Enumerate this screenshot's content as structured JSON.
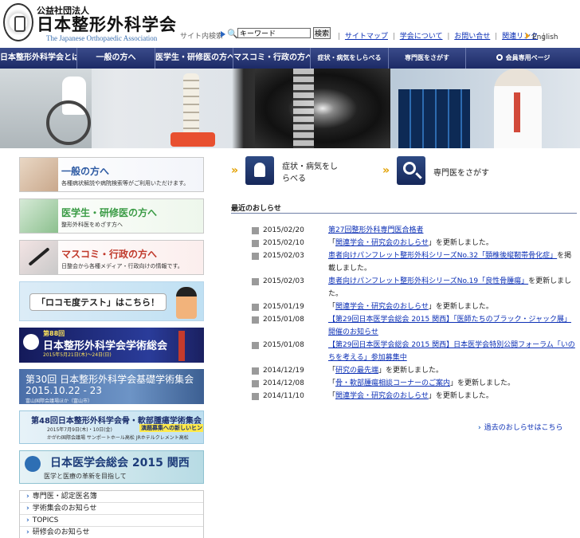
{
  "header": {
    "org_type": "公益社団法人",
    "org_name": "日本整形外科学会",
    "org_name_en": "The Japanese Orthopaedic Association",
    "search": {
      "label": "サイト内検索",
      "placeholder": "キーワード",
      "button": "検索"
    },
    "links": [
      {
        "label": "サイトマップ"
      },
      {
        "label": "学会について"
      },
      {
        "label": "お問い合せ"
      },
      {
        "label": "関連リンク"
      }
    ],
    "english_label": "English"
  },
  "nav": {
    "items": [
      {
        "label": "日本整形外科学会とは"
      },
      {
        "label": "一般の方へ"
      },
      {
        "label": "医学生・研修医の方へ"
      },
      {
        "label": "マスコミ・行政の方へ"
      },
      {
        "label": "症状・病気をしらべる"
      },
      {
        "label": "専門医をさがす"
      },
      {
        "label": "会員専用ページ"
      }
    ]
  },
  "sidebar": {
    "cards": [
      {
        "title": "一般の方へ",
        "desc": "各種病状解説や病院検索等がご利用いただけます。"
      },
      {
        "title": "医学生・研修医の方へ",
        "desc": "整形外科医をめざす方へ"
      },
      {
        "title": "マスコミ・行政の方へ",
        "desc": "日整会から各種メディア・行政向けの情報です。"
      }
    ],
    "locomo": {
      "label": "「ロコモ度テスト」はこちら！"
    },
    "events": {
      "e88": {
        "title": "第88回",
        "sub": "日本整形外科学会学術総会",
        "date": "2015年5月21日(木)〜24日(日)"
      },
      "e30": {
        "title": "第30回 日本整形外科学会基礎学術集会",
        "date": "2015.10.22 - 23",
        "sub": "富山国際会議場ほか（富山市）"
      },
      "e48": {
        "title": "第48回日本整形外科学会骨・軟部腫瘍学術集会",
        "date": "2015年7月9日(木)・10日(金)",
        "badge": "演題募集への新しいヒント",
        "sub": "かがわ国際会議場 サンポートホール高松 JRホテルクレメント高松"
      },
      "e29": {
        "title": "日本医学会総会 2015 関西",
        "sub": "医学と医療の革新を目指して"
      }
    },
    "quick_links": [
      {
        "label": "専門医・認定医名簿"
      },
      {
        "label": "学術集会のお知らせ"
      },
      {
        "label": "TOPICS"
      },
      {
        "label": "研修会のお知らせ"
      }
    ]
  },
  "features": {
    "symptoms_label": "症状・病気をしらべる",
    "specialist_label": "専門医をさがす"
  },
  "news": {
    "heading": "最近のおしらせ",
    "items": [
      {
        "date": "2015/02/20",
        "link": "第27回整形外科専門医合格者",
        "suffix": ""
      },
      {
        "date": "2015/02/10",
        "prefix": "「",
        "link": "関連学会・研究会のおしらせ",
        "suffix": "」を更新しました。"
      },
      {
        "date": "2015/02/03",
        "prefix": "",
        "link": "患者向けパンフレット整形外科シリーズNo.32「頚椎後縦靭帯骨化症」",
        "suffix": "を掲載しました。"
      },
      {
        "date": "2015/02/03",
        "prefix": "",
        "link": "患者向けパンフレット整形外科シリーズNo.19「良性骨腫瘍」",
        "suffix": "を更新しました。"
      },
      {
        "date": "2015/01/19",
        "prefix": "「",
        "link": "関連学会・研究会のおしらせ",
        "suffix": "」を更新しました。"
      },
      {
        "date": "2015/01/08",
        "prefix": "",
        "link": "【第29回日本医学会総会 2015 関西】「医師たちのブラック・ジャック展」開催のお知らせ",
        "suffix": ""
      },
      {
        "date": "2015/01/08",
        "prefix": "",
        "link": "【第29回日本医学会総会 2015 関西】日本医学会特別公開フォーラム「いのちを考える」参加募集中",
        "suffix": ""
      },
      {
        "date": "2014/12/19",
        "prefix": "「",
        "link": "研究の最先端",
        "suffix": "」を更新しました。"
      },
      {
        "date": "2014/12/08",
        "prefix": "「",
        "link": "骨・軟部腫瘍相談コーナーのご案内",
        "suffix": "」を更新しました。"
      },
      {
        "date": "2014/11/10",
        "prefix": "「",
        "link": "関連学会・研究会のおしらせ",
        "suffix": "」を更新しました。"
      }
    ],
    "past_link": "過去のおしらせはこちら"
  }
}
